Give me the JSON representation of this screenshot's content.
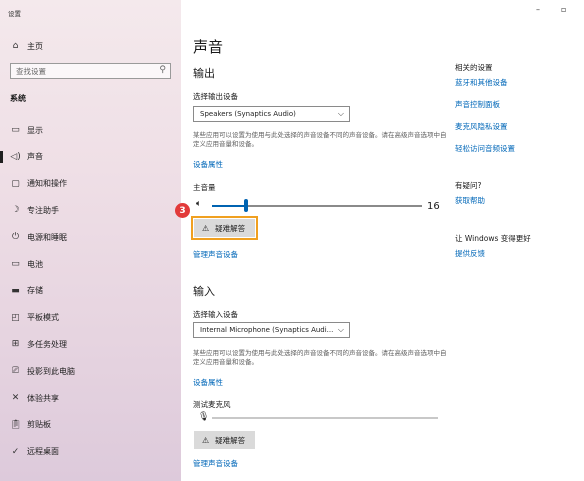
{
  "window": {
    "title": "设置",
    "minimize_glyph": "–",
    "restore_glyph": "▫"
  },
  "sidebar": {
    "home": "主页",
    "search_placeholder": "查找设置",
    "section": "系统",
    "items": [
      {
        "label": "显示",
        "icon": "display-icon"
      },
      {
        "label": "声音",
        "icon": "speaker-icon",
        "active": true
      },
      {
        "label": "通知和操作",
        "icon": "notification-icon"
      },
      {
        "label": "专注助手",
        "icon": "moon-icon"
      },
      {
        "label": "电源和睡眠",
        "icon": "power-icon"
      },
      {
        "label": "电池",
        "icon": "battery-icon"
      },
      {
        "label": "存储",
        "icon": "storage-icon"
      },
      {
        "label": "平板模式",
        "icon": "tablet-icon"
      },
      {
        "label": "多任务处理",
        "icon": "multitask-icon"
      },
      {
        "label": "投影到此电脑",
        "icon": "project-icon"
      },
      {
        "label": "体验共享",
        "icon": "share-icon"
      },
      {
        "label": "剪贴板",
        "icon": "clipboard-icon"
      },
      {
        "label": "远程桌面",
        "icon": "remote-icon"
      }
    ]
  },
  "main": {
    "title": "声音",
    "output": {
      "heading": "输出",
      "choose_label": "选择输出设备",
      "device": "Speakers (Synaptics Audio)",
      "note": "某些应用可以设置为使用与此处选择的声音设备不同的声音设备。请在高级声音选项中自定义应用音量和设备。",
      "device_props": "设备属性",
      "master_volume": "主音量",
      "volume_value": "16",
      "volume_level": 0.16,
      "troubleshoot": "疑难解答",
      "manage_devices": "管理声音设备",
      "step_badge": "3"
    },
    "input": {
      "heading": "输入",
      "choose_label": "选择输入设备",
      "device": "Internal Microphone (Synaptics Audi...",
      "note": "某些应用可以设置为使用与此处选择的声音设备不同的声音设备。请在高级声音选项中自定义应用音量和设备。",
      "device_props": "设备属性",
      "test_mic": "测试麦克风",
      "troubleshoot": "疑难解答",
      "manage_devices": "管理声音设备"
    }
  },
  "related": {
    "heading": "相关的设置",
    "links": [
      "蓝牙和其他设备",
      "声音控制面板",
      "麦克风隐私设置",
      "轻松访问音频设置"
    ],
    "help_heading": "有疑问?",
    "help_link": "获取帮助",
    "improve_heading": "让 Windows 变得更好",
    "feedback_link": "提供反馈"
  },
  "colors": {
    "accent": "#0067b8",
    "highlight": "#f0a020",
    "badge": "#e23a3a",
    "slider": "#0063b1"
  }
}
